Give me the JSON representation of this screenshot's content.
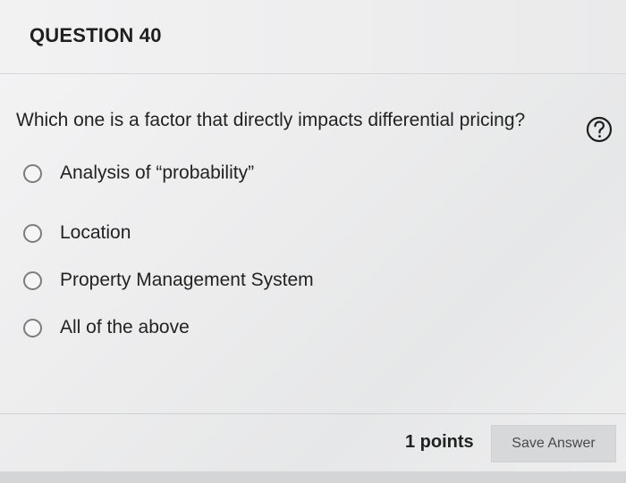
{
  "question": {
    "title": "QUESTION 40",
    "prompt": "Which one is a factor that directly impacts differential pricing?",
    "help_icon": "question-mark-circle-icon",
    "options": [
      "Analysis of “probability”",
      "Location",
      "Property Management System",
      "All of the above"
    ]
  },
  "footer": {
    "points": "1 points",
    "save_label": "Save Answer"
  }
}
